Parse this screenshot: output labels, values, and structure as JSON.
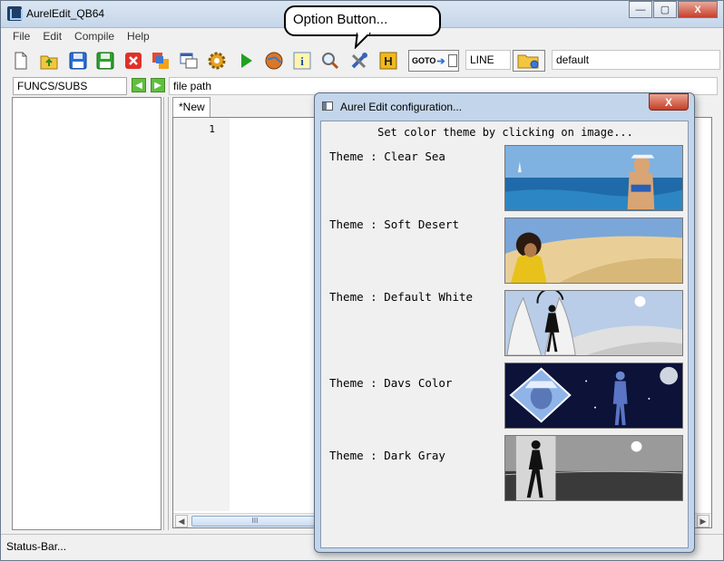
{
  "window": {
    "title": "AurelEdit_QB64",
    "buttons": {
      "minimize": "—",
      "maximize": "▢",
      "close": "X"
    }
  },
  "menu": [
    "File",
    "Edit",
    "Compile",
    "Help"
  ],
  "toolbar": {
    "buttons": [
      "new-file",
      "open-file",
      "save",
      "save-as",
      "close-file",
      "run-external",
      "window-switch",
      "settings",
      "run",
      "web",
      "info",
      "find",
      "options",
      "help"
    ],
    "goto_label": "GOTO",
    "line_value": "LINE",
    "default_value": "default"
  },
  "subs_combo": "FUNCS/SUBS",
  "filepath": "file path",
  "editor": {
    "tab_label": "*New",
    "line_numbers": [
      "1"
    ],
    "scroll_thumb": "III"
  },
  "status": "Status-Bar...",
  "callout": "Option Button...",
  "dialog": {
    "title": "Aurel Edit configuration...",
    "close_label": "X",
    "heading": "Set color theme by clicking on image...",
    "themes": [
      {
        "label": "Theme : Clear Sea"
      },
      {
        "label": "Theme : Soft Desert"
      },
      {
        "label": "Theme : Default White"
      },
      {
        "label": "Theme : Davs Color"
      },
      {
        "label": "Theme : Dark Gray"
      }
    ]
  },
  "colors": {
    "titlebar": "#c5d6ea",
    "close_red": "#c7402a",
    "dialog_frame": "#c3d5ea"
  }
}
